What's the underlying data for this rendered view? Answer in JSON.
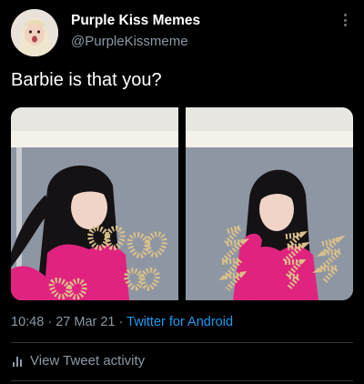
{
  "tweet": {
    "author": {
      "display_name": "Purple Kiss Memes",
      "handle": "@PurpleKissmeme"
    },
    "text": "Barbie is that you?",
    "time": "10:48",
    "separator": "·",
    "date": "27 Mar 21",
    "source": "Twitter for Android",
    "activity_label": "View Tweet activity"
  },
  "icons": {
    "more": "more-vertical-icon",
    "activity": "bar-chart-icon"
  },
  "colors": {
    "background": "#000000",
    "text": "#ffffff",
    "secondary": "#8b98a5",
    "link": "#1d9bf0",
    "divider": "#2f3336"
  }
}
